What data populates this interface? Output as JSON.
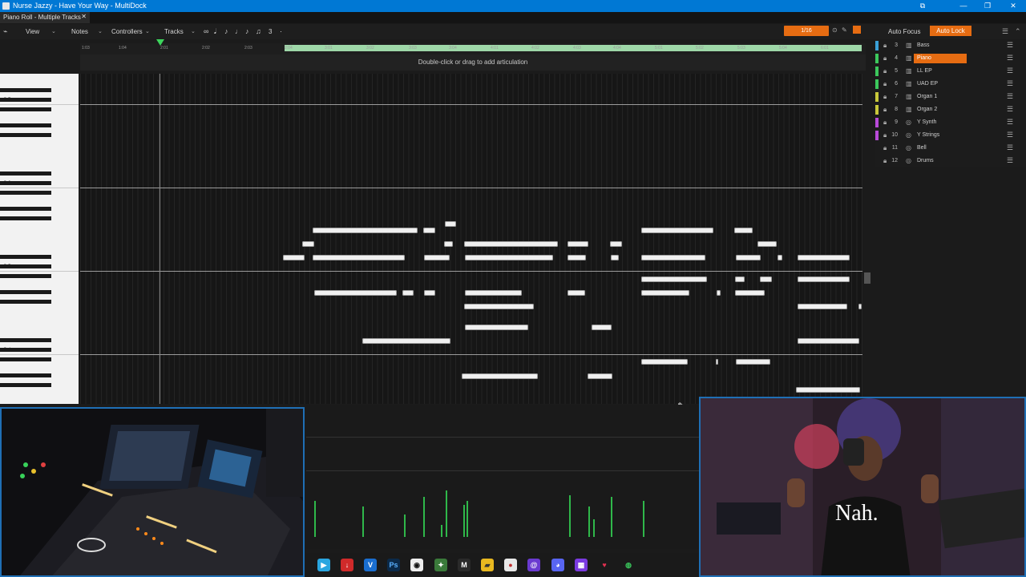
{
  "window": {
    "title": "Nurse Jazzy - Have Your Way - MultiDock",
    "controls": [
      "⧉",
      "—",
      "❐",
      "✕"
    ]
  },
  "tab": {
    "label": "Piano Roll - Multiple Tracks",
    "close": "✕"
  },
  "menu": {
    "view": "View",
    "notes": "Notes",
    "controllers": "Controllers",
    "tracks": "Tracks",
    "tools_count": "3",
    "snap": "1/16"
  },
  "right_header": {
    "auto_focus": "Auto Focus",
    "auto_lock": "Auto Lock"
  },
  "ruler": {
    "labels": [
      "1:03",
      "1:04",
      "2:01",
      "2:02",
      "2:03",
      "2:04",
      "3:01",
      "3:02",
      "3:03",
      "3:04",
      "4:01",
      "4:02",
      "4:03",
      "4:04",
      "5:01",
      "5:02",
      "5:03",
      "5:04",
      "6:01"
    ]
  },
  "articulation_hint": "Double-click or drag to add articulation",
  "keyboard": {
    "labels": [
      "C 7",
      "C 6",
      "C 5",
      "C 4"
    ]
  },
  "tracks": [
    {
      "num": "3",
      "name": "Bass",
      "color": "#3aa0d8",
      "icon": "▥"
    },
    {
      "num": "4",
      "name": "Piano",
      "color": "#3cc85c",
      "icon": "▥",
      "active": true
    },
    {
      "num": "5",
      "name": "LL EP",
      "color": "#3cc85c",
      "icon": "▥"
    },
    {
      "num": "6",
      "name": "UAD EP",
      "color": "#3cc85c",
      "icon": "▥"
    },
    {
      "num": "7",
      "name": "Organ 1",
      "color": "#c8c83a",
      "icon": "▥"
    },
    {
      "num": "8",
      "name": "Organ 2",
      "color": "#c8c83a",
      "icon": "▥"
    },
    {
      "num": "9",
      "name": "Y Synth",
      "color": "#b84ad8",
      "icon": "◎"
    },
    {
      "num": "10",
      "name": "Y Strings",
      "color": "#b84ad8",
      "icon": "◎"
    },
    {
      "num": "11",
      "name": "Bell",
      "color": "#1c1c1c",
      "icon": "◎"
    },
    {
      "num": "12",
      "name": "Drums",
      "color": "#1c1c1c",
      "icon": "◎"
    }
  ],
  "webcam_caption": "Nah."
}
